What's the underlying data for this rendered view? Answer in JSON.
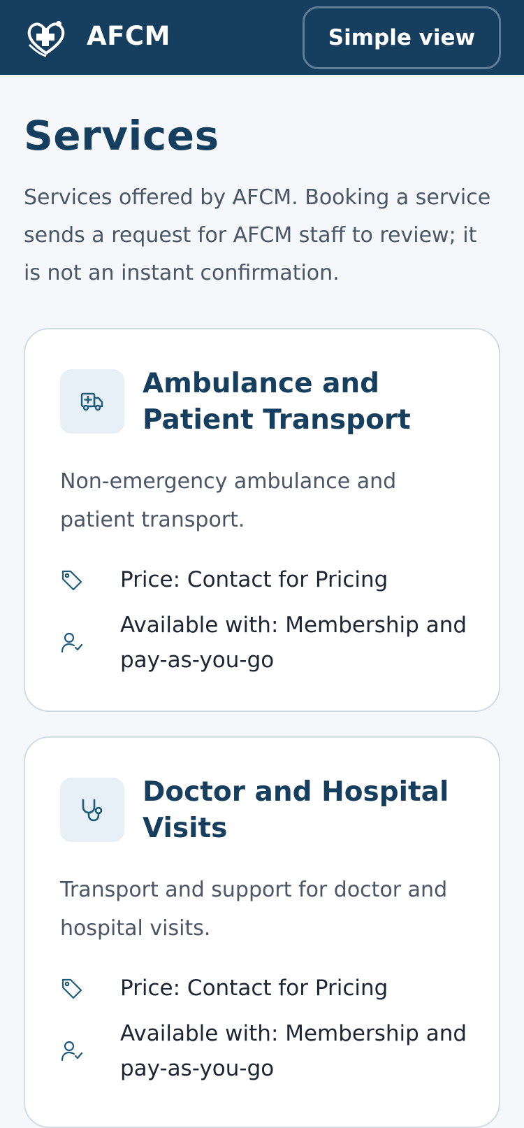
{
  "header": {
    "brand": "AFCM",
    "simple_view_label": "Simple view"
  },
  "page": {
    "title": "Services",
    "intro": "Services offered by AFCM. Booking a service sends a request for AFCM staff to review; it is not an instant confirmation."
  },
  "services": [
    {
      "icon": "ambulance-icon",
      "title": "Ambulance and Patient Transport",
      "description": "Non-emergency ambulance and patient transport.",
      "price": "Price: Contact for Pricing",
      "availability": "Available with: Membership and pay-as-you-go"
    },
    {
      "icon": "stethoscope-icon",
      "title": "Doctor and Hospital Visits",
      "description": "Transport and support for doctor and hospital visits.",
      "price": "Price: Contact for Pricing",
      "availability": "Available with: Membership and pay-as-you-go"
    }
  ],
  "colors": {
    "header_bg": "#163e5e",
    "accent": "#163e5e",
    "icon_tint": "#1c5a78",
    "page_bg": "#f5f8fb"
  }
}
